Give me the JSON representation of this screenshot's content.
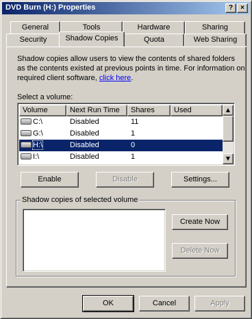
{
  "window": {
    "title": "DVD Burn (H:) Properties",
    "help_glyph": "?",
    "close_glyph": "×"
  },
  "tabs": {
    "row_back": [
      "General",
      "Tools",
      "Hardware",
      "Sharing"
    ],
    "row_front": [
      "Security",
      "Shadow Copies",
      "Quota",
      "Web Sharing"
    ],
    "active": "Shadow Copies"
  },
  "description": {
    "line1": "Shadow copies allow users to view the contents of shared folders",
    "line2": "as the contents existed at previous points in time. For information on",
    "line3_prefix": "required client software, ",
    "link": "click here",
    "line3_suffix": "."
  },
  "volume_list": {
    "label": "Select a volume:",
    "columns": [
      "Volume",
      "Next Run Time",
      "Shares",
      "Used"
    ],
    "rows": [
      {
        "volume": "C:\\",
        "next_run": "Disabled",
        "shares": "11",
        "used": ""
      },
      {
        "volume": "G:\\",
        "next_run": "Disabled",
        "shares": "1",
        "used": ""
      },
      {
        "volume": "H:\\",
        "next_run": "Disabled",
        "shares": "0",
        "used": ""
      },
      {
        "volume": "I:\\",
        "next_run": "Disabled",
        "shares": "1",
        "used": ""
      }
    ],
    "selected": "H:\\"
  },
  "volume_buttons": {
    "enable": "Enable",
    "disable": "Disable",
    "settings": "Settings..."
  },
  "shadow_group": {
    "title": "Shadow copies of selected volume",
    "create_now": "Create Now",
    "delete_now": "Delete Now"
  },
  "dialog_buttons": {
    "ok": "OK",
    "cancel": "Cancel",
    "apply": "Apply"
  },
  "colors": {
    "face": "#d4d0c8",
    "title_start": "#0a246a",
    "title_end": "#a6caf0",
    "selection": "#0a246a",
    "link": "#0000ff"
  }
}
